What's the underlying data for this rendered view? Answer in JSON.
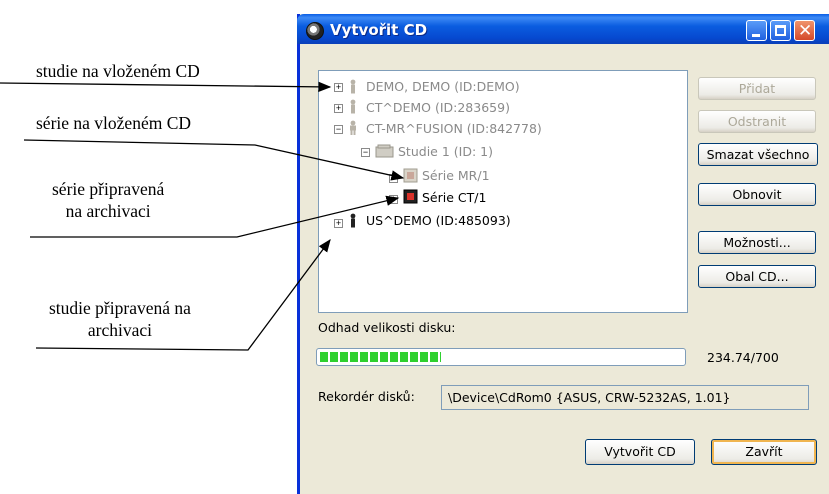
{
  "annotations": {
    "study_on_cd": "studie na vloženém CD",
    "series_on_cd": "série na vloženém CD",
    "series_prepared_l1": "série připravená",
    "series_prepared_l2": "na archivaci",
    "study_prepared_l1": "studie připravená na",
    "study_prepared_l2": "archivaci"
  },
  "window": {
    "title": "Vytvořit CD"
  },
  "tree": [
    {
      "label": "DEMO, DEMO (ID:DEMO)",
      "icon": "patient-icon",
      "state": "on-cd"
    },
    {
      "label": "CT^DEMO (ID:283659)",
      "icon": "patient-icon",
      "state": "on-cd"
    },
    {
      "label": "CT-MR^FUSION (ID:842778)",
      "icon": "patient-icon",
      "state": "on-cd"
    },
    {
      "label": "Studie 1 (ID: 1)",
      "icon": "study-icon",
      "state": "on-cd"
    },
    {
      "label": "Série MR/1",
      "icon": "series-icon",
      "state": "on-cd"
    },
    {
      "label": "Série CT/1",
      "icon": "series-icon",
      "state": "prepared"
    },
    {
      "label": "US^DEMO (ID:485093)",
      "icon": "patient-icon",
      "state": "prepared"
    }
  ],
  "buttons": {
    "add": "Přidat",
    "remove": "Odstranit",
    "clear_all": "Smazat všechno",
    "refresh": "Obnovit",
    "options": "Možnosti...",
    "cd_cover": "Obal CD...",
    "create_cd": "Vytvořit CD",
    "close": "Zavřít"
  },
  "disk_size": {
    "label": "Odhad velikosti disku:",
    "value_text": "234.74/700",
    "fraction": 0.335
  },
  "recorder": {
    "label": "Rekordér disků:",
    "value": "\\Device\\CdRom0 {ASUS, CRW-5232AS, 1.01}"
  },
  "colors": {
    "titlebar": "#0a5ee5",
    "progress": "#2fd02f",
    "on_cd_text": "#8a8a8a",
    "prepared_text": "#000000"
  }
}
